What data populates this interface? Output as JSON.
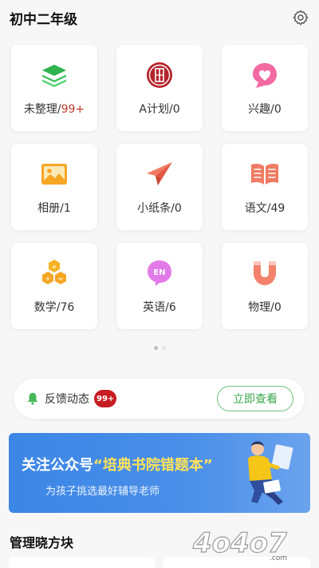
{
  "header": {
    "title": "初中二年级",
    "settings_icon": "gear-icon"
  },
  "tiles": [
    {
      "label": "未整理/",
      "count": "99+",
      "count_color": "red",
      "icon": "layers-icon"
    },
    {
      "label": "A计划/",
      "count": "0",
      "icon": "plan-seal-icon"
    },
    {
      "label": "兴趣/",
      "count": "0",
      "icon": "heart-bubble-icon"
    },
    {
      "label": "相册/",
      "count": "1",
      "icon": "photo-album-icon"
    },
    {
      "label": "小纸条/",
      "count": "0",
      "icon": "paper-plane-icon"
    },
    {
      "label": "语文/",
      "count": "49",
      "icon": "book-icon"
    },
    {
      "label": "数学/",
      "count": "76",
      "icon": "math-hex-icon"
    },
    {
      "label": "英语/",
      "count": "6",
      "icon": "en-bubble-icon"
    },
    {
      "label": "物理/",
      "count": "0",
      "icon": "magnet-icon"
    }
  ],
  "pager": {
    "pages": 2,
    "active": 0
  },
  "feedback": {
    "label": "反馈动态",
    "badge": "99+",
    "button": "立即查看",
    "icon": "bell-icon"
  },
  "banner": {
    "prefix": "关注公众号",
    "highlight": "“培典书院错题本”",
    "subtitle": "为孩子挑选最好辅导老师"
  },
  "section": {
    "title": "管理晓方块"
  },
  "watermark": {
    "text": "4o4o7.com"
  },
  "colors": {
    "green": "#3aa74b",
    "red_badge": "#c61d23",
    "banner_blue": "#3c86e6",
    "pink": "#f26aa2",
    "orange": "#f5a623",
    "coral": "#f07b62"
  }
}
